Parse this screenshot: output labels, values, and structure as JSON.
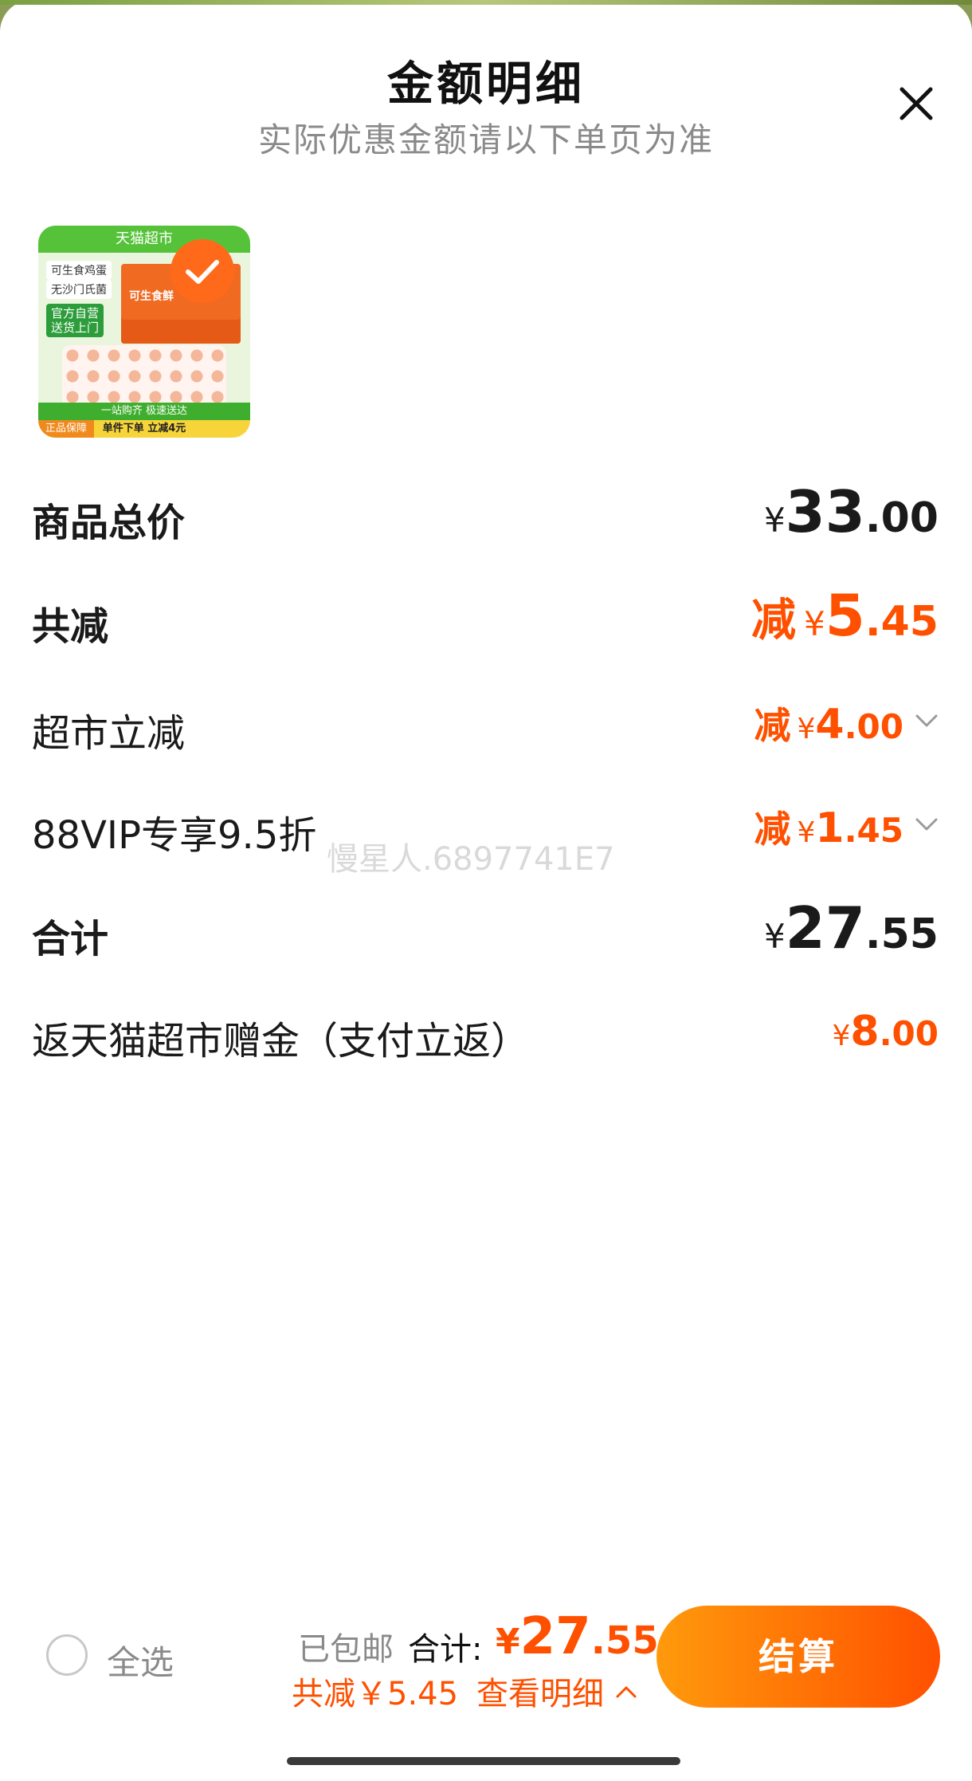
{
  "title": "金额明细",
  "subtitle": "实际优惠金额请以下单页为准",
  "icons": {
    "close": "close-icon",
    "check": "check-icon",
    "chevron": "chevron-down-icon",
    "chevron_up": "chevron-up-icon"
  },
  "product_image": {
    "brand": "天猫超市",
    "tag1": "可生食鸡蛋",
    "tag2": "无沙门氏菌",
    "tag3_line1": "官方自营",
    "tag3_line2": "送货上门",
    "box_label": "可生食鲜",
    "bar1": "一站购齐 极速送达",
    "bar2": "单件下单 立减4元",
    "guarantee": "正品保障"
  },
  "rows": {
    "goods_total": {
      "label": "商品总价",
      "currency": "¥",
      "int": "33",
      "dec": ".00"
    },
    "total_discount": {
      "label": "共减",
      "prefix": "减",
      "currency": "¥",
      "int": "5",
      "dec": ".45"
    },
    "market_discount": {
      "label": "超市立减",
      "prefix": "减",
      "currency": "¥",
      "int": "4",
      "dec": ".00"
    },
    "vip_discount": {
      "label": "88VIP专享9.5折",
      "prefix": "减",
      "currency": "¥",
      "int": "1",
      "dec": ".45"
    },
    "subtotal": {
      "label": "合计",
      "currency": "¥",
      "int": "27",
      "dec": ".55"
    },
    "cashback": {
      "label": "返天猫超市赠金（支付立返）",
      "currency": "¥",
      "int": "8",
      "dec": ".00"
    }
  },
  "watermark": "慢星人.6897741E7",
  "footer": {
    "select_all": "全选",
    "shipping": "已包邮",
    "total_label": "合计:",
    "total_currency": "¥",
    "total_int": "27",
    "total_dec": ".55",
    "saved": "共减￥5.45",
    "view_detail": "查看明细",
    "pay_button": "结算"
  },
  "colors": {
    "accent": "#ff5000",
    "pay_start": "#ff9a0c",
    "pay_end": "#ff5000",
    "muted": "#8a8a8a"
  }
}
